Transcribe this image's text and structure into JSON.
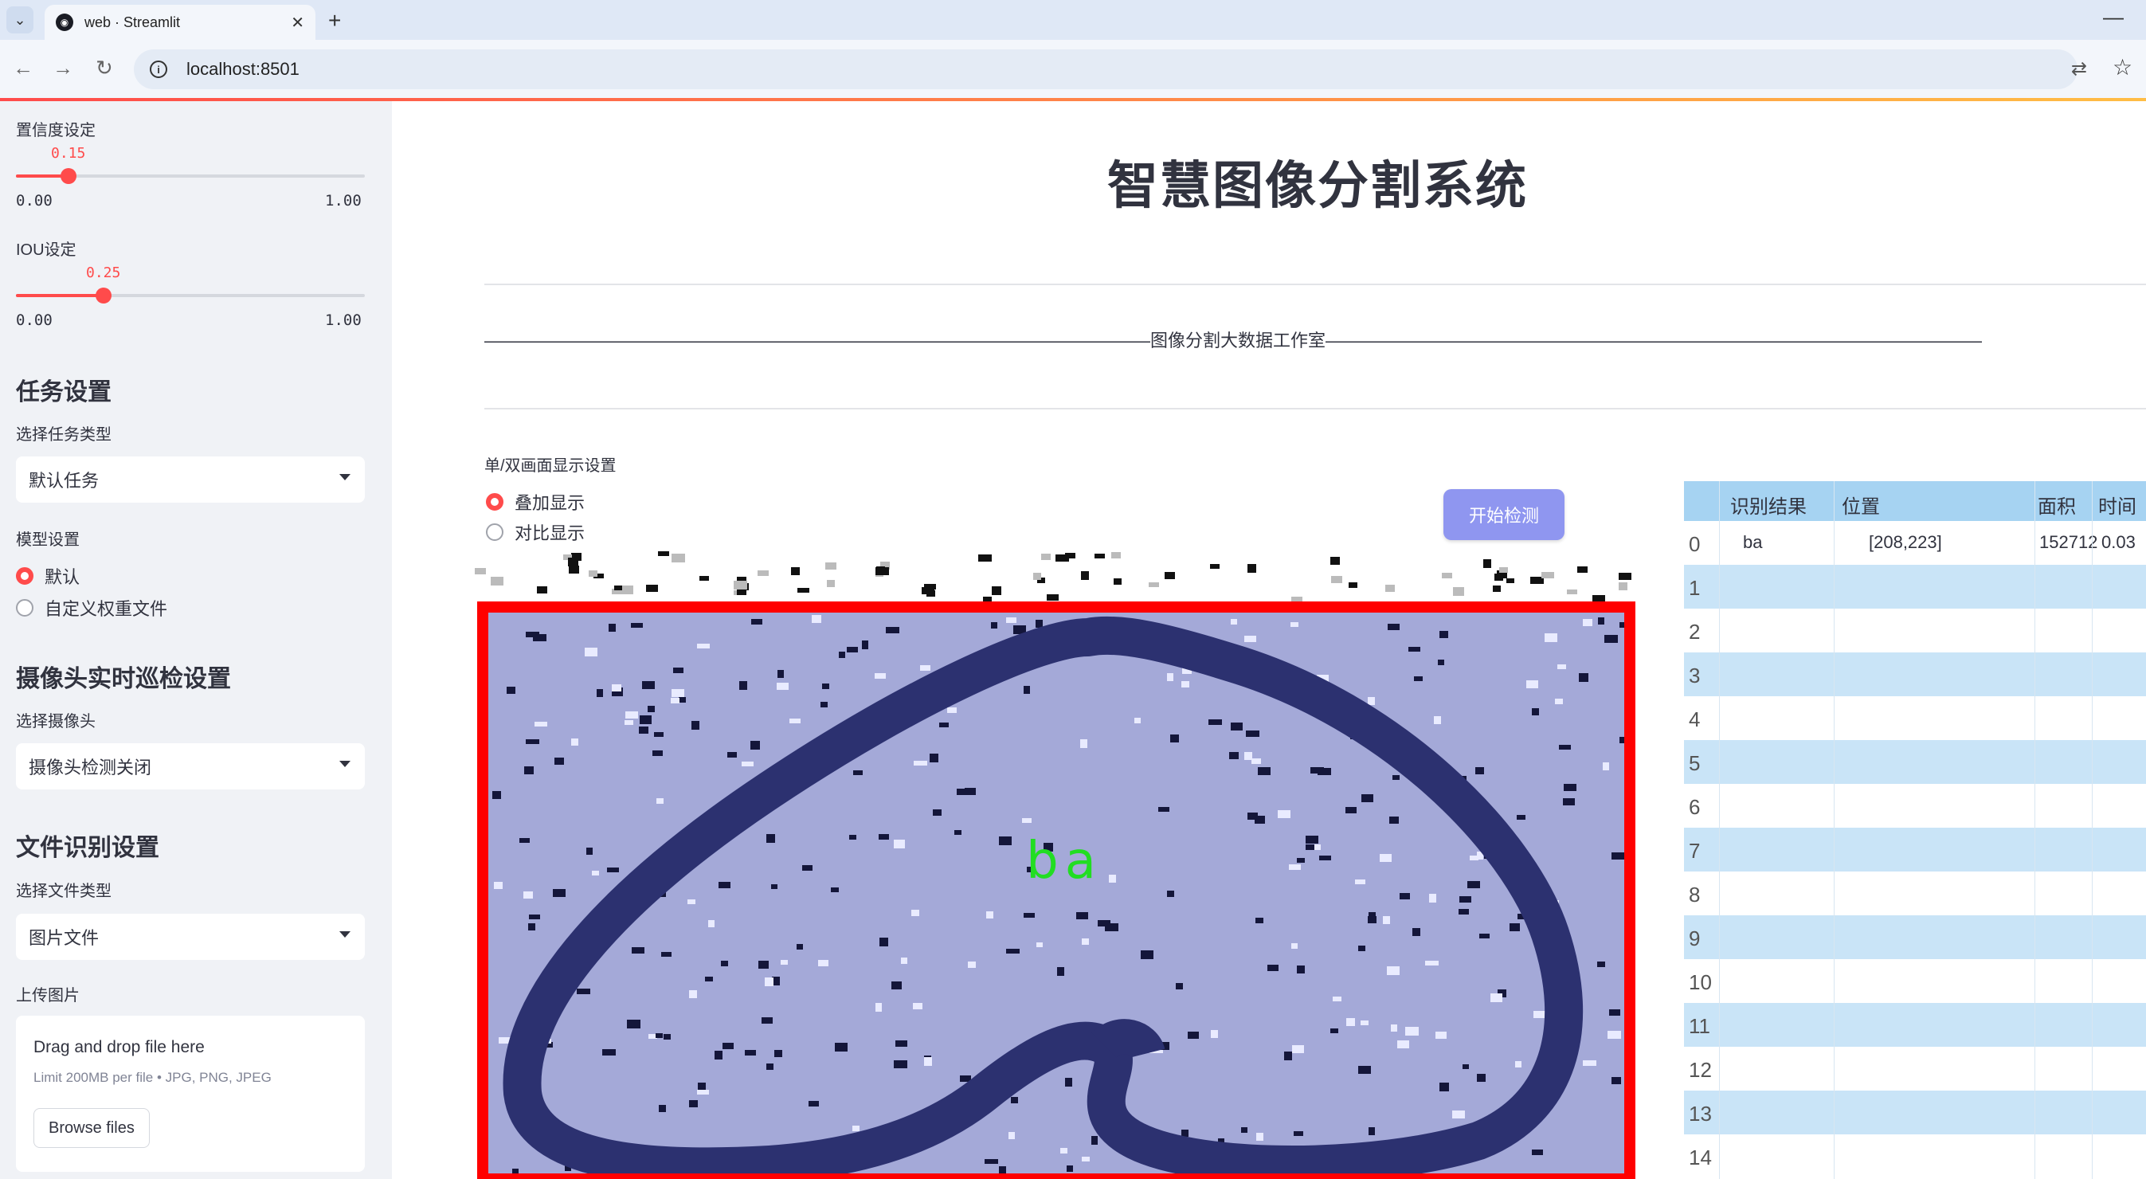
{
  "browser": {
    "tab_title": "web · Streamlit",
    "url": "localhost:8501"
  },
  "sidebar": {
    "confidence": {
      "label": "置信度设定",
      "value": "0.15",
      "fraction": 0.15,
      "min": "0.00",
      "max": "1.00"
    },
    "iou": {
      "label": "IOU设定",
      "value": "0.25",
      "fraction": 0.25,
      "min": "0.00",
      "max": "1.00"
    },
    "task_heading": "任务设置",
    "task_type_label": "选择任务类型",
    "task_type_value": "默认任务",
    "model_label": "模型设置",
    "model_options": [
      "默认",
      "自定义权重文件"
    ],
    "model_selected": 0,
    "camera_heading": "摄像头实时巡检设置",
    "camera_label": "选择摄像头",
    "camera_value": "摄像头检测关闭",
    "file_heading": "文件识别设置",
    "file_type_label": "选择文件类型",
    "file_type_value": "图片文件",
    "upload_label": "上传图片",
    "upload_title": "Drag and drop file here",
    "upload_limit": "Limit 200MB per file • JPG, PNG, JPEG",
    "browse_button": "Browse files"
  },
  "main": {
    "title": "智慧图像分割系统",
    "divider_text": "——————————————————————————————————————图像分割大数据工作室——————————————————————————————————————",
    "display_label": "单/双画面显示设置",
    "display_options": [
      "叠加显示",
      "对比显示"
    ],
    "display_selected": 0,
    "start_button": "开始检测",
    "detection_label": "ba"
  },
  "table": {
    "headers": [
      "识别结果",
      "位置",
      "面积",
      "时间"
    ],
    "rows": [
      {
        "index": "0",
        "result": "ba",
        "position": "[208,223]",
        "area": "152712",
        "time": "0.03"
      },
      {
        "index": "1"
      },
      {
        "index": "2"
      },
      {
        "index": "3"
      },
      {
        "index": "4"
      },
      {
        "index": "5"
      },
      {
        "index": "6"
      },
      {
        "index": "7"
      },
      {
        "index": "8"
      },
      {
        "index": "9"
      },
      {
        "index": "10"
      },
      {
        "index": "11"
      },
      {
        "index": "12"
      },
      {
        "index": "13"
      },
      {
        "index": "14"
      }
    ]
  },
  "colors": {
    "accent": "#ff4b4b",
    "sidebar_bg": "#f0f2f6",
    "button": "#8f96f0",
    "box": "#ff0000",
    "label_text": "#22dd22",
    "segment": "#a4a9d8",
    "stroke": "#2c3170"
  },
  "icons": [
    "chevron-down-icon",
    "streamlit-icon",
    "close-icon",
    "plus-icon",
    "minimize-icon",
    "back-icon",
    "forward-icon",
    "reload-icon",
    "info-icon",
    "translate-icon",
    "star-icon"
  ]
}
